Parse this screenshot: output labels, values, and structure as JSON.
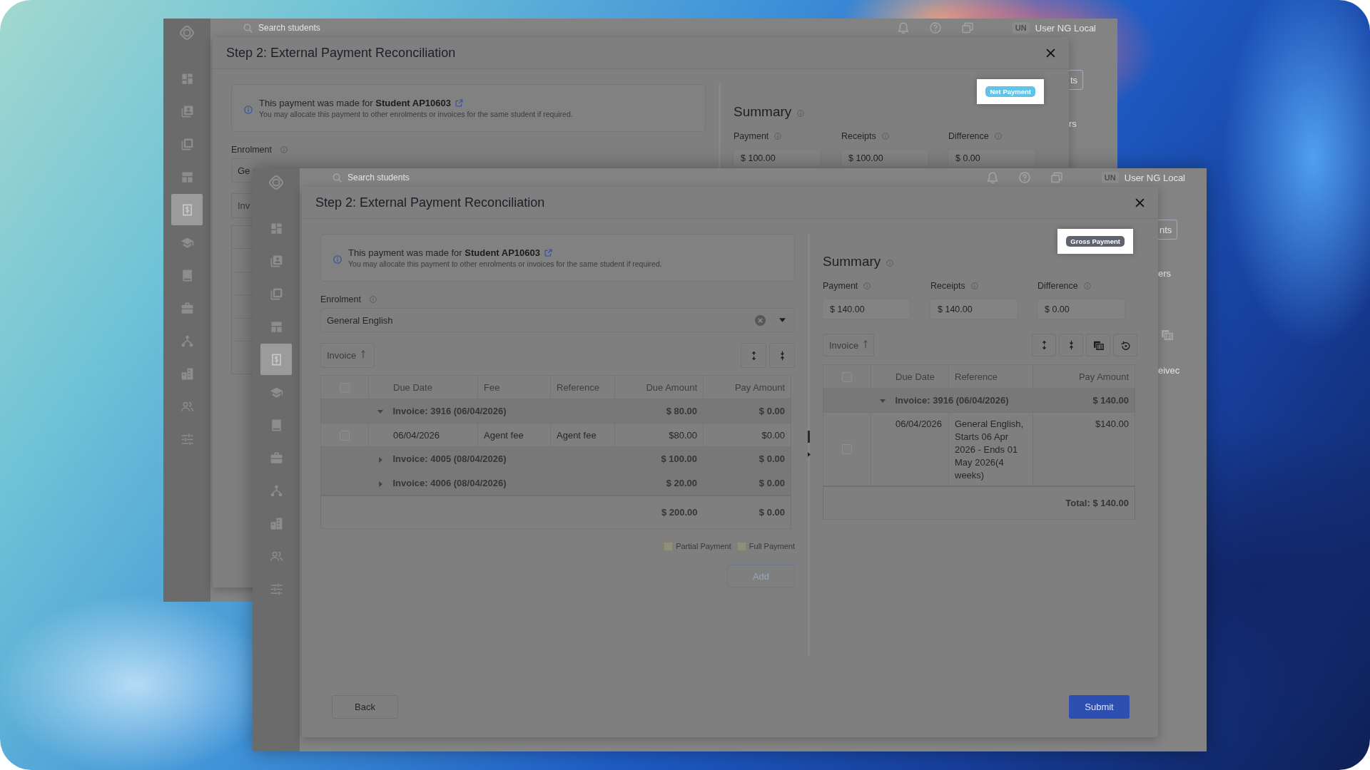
{
  "desktop": {
    "windows": [
      {
        "sidebar": {
          "items": [
            {
              "kind": "dashboard",
              "selected": false
            },
            {
              "kind": "contacts",
              "selected": false
            },
            {
              "kind": "copies",
              "selected": false
            },
            {
              "kind": "layout",
              "selected": false
            },
            {
              "kind": "billing",
              "selected": true
            },
            {
              "kind": "courses",
              "selected": false
            },
            {
              "kind": "book",
              "selected": false
            },
            {
              "kind": "briefcase",
              "selected": false
            },
            {
              "kind": "network",
              "selected": false
            },
            {
              "kind": "buildings",
              "selected": false
            },
            {
              "kind": "people",
              "selected": false
            },
            {
              "kind": "sliders",
              "selected": false
            }
          ]
        },
        "top_bar": {
          "search": {
            "placeholder": "Search students"
          },
          "avatar": "UN",
          "user": "User NG Local"
        },
        "page_behind": [
          {
            "kind": "button",
            "text": "ts"
          },
          {
            "kind": "text",
            "text": "rs"
          }
        ],
        "dialog": {
          "title": "Step 2: External Payment Reconciliation",
          "notice": {
            "text": "This payment was made for **Student AP10603**",
            "subtext": "You may allocate this payment to other enrolments or invoices for the same student if required."
          },
          "enrolment": {
            "label": "Enrolment",
            "value": "Ge"
          },
          "sort_button": {
            "label": "Inv"
          },
          "badge": {
            "text": "Net Payment",
            "color": "#5fc3ea"
          },
          "summary": {
            "title": "Summary",
            "fields": [
              {
                "label": "Payment",
                "value": "$ 100.00"
              },
              {
                "label": "Receipts",
                "value": "$ 100.00"
              },
              {
                "label": "Difference",
                "value": "$ 0.00"
              }
            ]
          }
        }
      },
      {
        "sidebar": {
          "items": [
            {
              "kind": "dashboard",
              "selected": false
            },
            {
              "kind": "contacts",
              "selected": false
            },
            {
              "kind": "copies",
              "selected": false
            },
            {
              "kind": "layout",
              "selected": false
            },
            {
              "kind": "billing",
              "selected": true
            },
            {
              "kind": "courses",
              "selected": false
            },
            {
              "kind": "book",
              "selected": false
            },
            {
              "kind": "briefcase",
              "selected": false
            },
            {
              "kind": "network",
              "selected": false
            },
            {
              "kind": "buildings",
              "selected": false
            },
            {
              "kind": "people",
              "selected": false
            },
            {
              "kind": "sliders",
              "selected": false
            }
          ]
        },
        "top_bar": {
          "search": {
            "placeholder": "Search students"
          },
          "avatar": "UN",
          "user": "User NG Local"
        },
        "page_behind": [
          {
            "kind": "button",
            "text": "nts"
          },
          {
            "kind": "text",
            "text": "ers"
          },
          {
            "kind": "icon"
          },
          {
            "kind": "text",
            "text": "eivec"
          }
        ],
        "dialog": {
          "title": "Step 2: External Payment Reconciliation",
          "notice": {
            "text": "This payment was made for **Student AP10603**",
            "subtext": "You may allocate this payment to other enrolments or invoices for the same student if required."
          },
          "enrolment": {
            "label": "Enrolment",
            "value": "General English",
            "clearable": true
          },
          "sort_button": {
            "label": "Invoice",
            "sorted": true
          },
          "actions": [
            {
              "kind": "expand"
            },
            {
              "kind": "collapse"
            }
          ],
          "table": {
            "columns": [
              "Due Date",
              "Fee",
              "Reference",
              "Due Amount",
              "Pay Amount"
            ],
            "header_checked": false,
            "rows": [
              {
                "kind": "group",
                "label": "Invoice: 3916 (06/04/2026)",
                "expanded": true,
                "amounts": [
                  "$ 80.00",
                  "$ 0.00"
                ]
              },
              {
                "kind": "item",
                "checked": false,
                "cells": [
                  "06/04/2026",
                  "Agent fee",
                  "Agent fee",
                  "$80.00",
                  "$0.00"
                ]
              },
              {
                "kind": "group",
                "label": "Invoice: 4005 (08/04/2026)",
                "expanded": false,
                "amounts": [
                  "$ 100.00",
                  "$ 0.00"
                ]
              },
              {
                "kind": "group",
                "label": "Invoice: 4006 (08/04/2026)",
                "expanded": false,
                "amounts": [
                  "$ 20.00",
                  "$ 0.00"
                ]
              }
            ],
            "totals": [
              "$ 200.00",
              "$ 0.00"
            ]
          },
          "legend": [
            {
              "label": "Partial Payment",
              "color": "#908f7a"
            },
            {
              "label": "Full Payment",
              "color": "#8a9177"
            }
          ],
          "add_button": {
            "label": "Add",
            "disabled": true
          },
          "splitter": {
            "handle": true
          },
          "badge": {
            "text": "Gross Payment",
            "color": "#5e636d"
          },
          "summary": {
            "title": "Summary",
            "fields": [
              {
                "label": "Payment",
                "value": "$ 140.00"
              },
              {
                "label": "Receipts",
                "value": "$ 140.00"
              },
              {
                "label": "Difference",
                "value": "$ 0.00"
              }
            ]
          },
          "summary_toolbar": {
            "sort_button": {
              "label": "Invoice",
              "sorted": true
            },
            "actions": [
              {
                "kind": "expand"
              },
              {
                "kind": "collapse"
              },
              {
                "kind": "documents"
              },
              {
                "kind": "reset"
              }
            ]
          },
          "summary_table": {
            "columns": [
              "Due Date",
              "Reference",
              "Pay Amount"
            ],
            "header_checked": false,
            "rows": [
              {
                "kind": "group",
                "label": "Invoice: 3916 (06/04/2026)",
                "expanded": true,
                "amounts": [
                  "$ 140.00"
                ]
              },
              {
                "kind": "item",
                "checked": false,
                "cells": [
                  "06/04/2026",
                  "General English, Starts 06 Apr 2026 - Ends 01 May 2026(4 weeks)",
                  "$140.00"
                ]
              }
            ],
            "totals": [
              "Total: $ 140.00"
            ]
          },
          "footer": {
            "back": "Back",
            "submit": "Submit"
          }
        }
      }
    ]
  }
}
